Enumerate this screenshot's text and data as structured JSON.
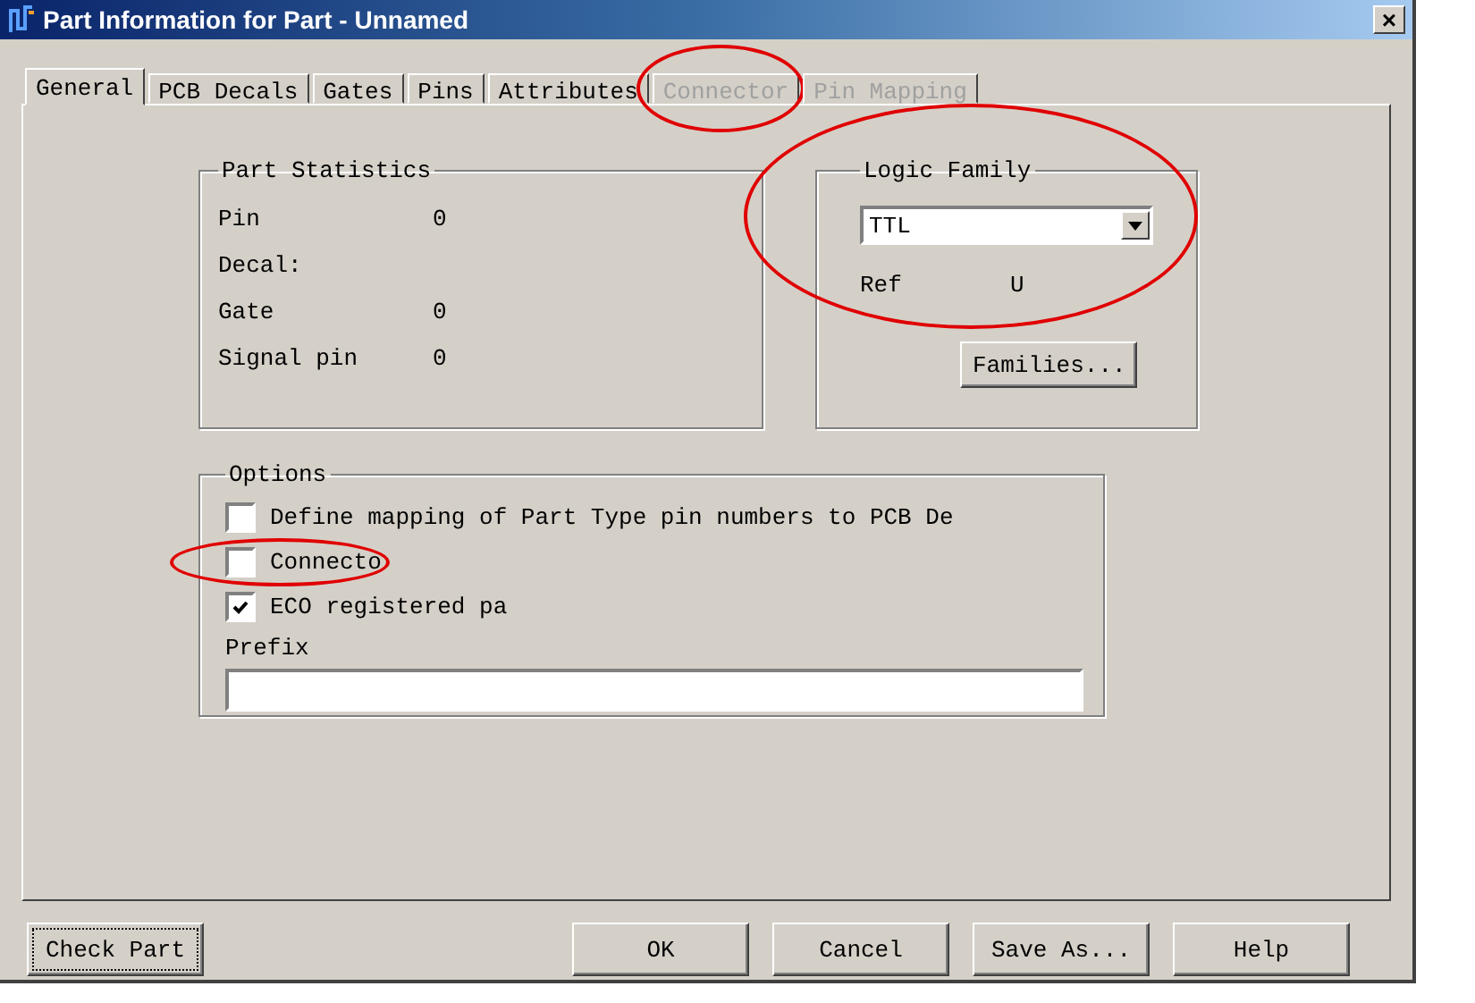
{
  "window": {
    "title": "Part Information for Part - Unnamed",
    "close": "×"
  },
  "tabs": [
    {
      "label": "General",
      "selected": true,
      "disabled": false,
      "circled": false
    },
    {
      "label": "PCB Decals",
      "selected": false,
      "disabled": false,
      "circled": false
    },
    {
      "label": "Gates",
      "selected": false,
      "disabled": false,
      "circled": false
    },
    {
      "label": "Pins",
      "selected": false,
      "disabled": false,
      "circled": false
    },
    {
      "label": "Attributes",
      "selected": false,
      "disabled": false,
      "circled": false
    },
    {
      "label": "Connector",
      "selected": false,
      "disabled": true,
      "circled": true
    },
    {
      "label": "Pin Mapping",
      "selected": false,
      "disabled": true,
      "circled": false
    }
  ],
  "part_statistics": {
    "title": "Part Statistics",
    "rows": [
      {
        "label": "Pin",
        "value": "0"
      },
      {
        "label": "Decal:"
      },
      {
        "label": "Gate",
        "value": "0"
      },
      {
        "label": "Signal pin",
        "value": "0"
      }
    ]
  },
  "logic_family": {
    "title": "Logic Family",
    "circled": true,
    "dropdown": "TTL",
    "ref_label": "Ref",
    "ref_value": "U",
    "button": "Families..."
  },
  "options": {
    "title": "Options",
    "checkboxes": [
      {
        "label": "Define mapping of Part Type pin numbers to PCB De",
        "checked": false,
        "circled": false
      },
      {
        "label": "Connecto",
        "checked": false,
        "circled": true
      },
      {
        "label": "ECO registered pa",
        "checked": true,
        "circled": false
      }
    ],
    "prefix_label": "Prefix"
  },
  "buttons": {
    "left": "Check Part",
    "right": [
      "OK",
      "Cancel",
      "Save As...",
      "Help"
    ]
  }
}
